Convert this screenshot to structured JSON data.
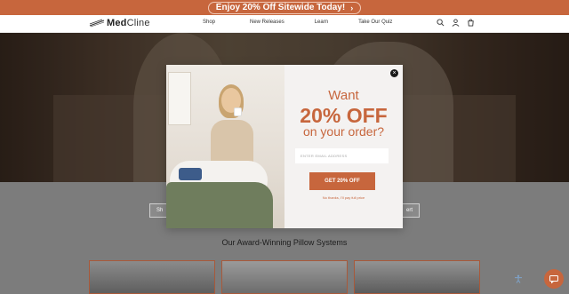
{
  "promo": {
    "text": "Enjoy 20% Off Sitewide Today!",
    "arrow": "›"
  },
  "header": {
    "logo_bold": "Med",
    "logo_light": "Cline",
    "nav": [
      "Shop",
      "New Releases",
      "Learn",
      "Take Our Quiz"
    ],
    "icons": [
      "search-icon",
      "account-icon",
      "cart-icon"
    ]
  },
  "hero": {
    "left_button": "Sh",
    "right_button": "ert"
  },
  "section": {
    "title": "Our Award-Winning Pillow Systems"
  },
  "modal": {
    "line1": "Want",
    "line2": "20% OFF",
    "line3": "on your order?",
    "email_placeholder": "ENTER EMAIL ADDRESS",
    "cta": "GET 20% OFF",
    "decline": "No thanks, I'll pay full price",
    "close": "×"
  },
  "colors": {
    "accent": "#c7663d",
    "modal_bg": "#f4f2f1"
  },
  "widgets": {
    "chat": "chat-icon",
    "accessibility": "accessibility-icon"
  }
}
